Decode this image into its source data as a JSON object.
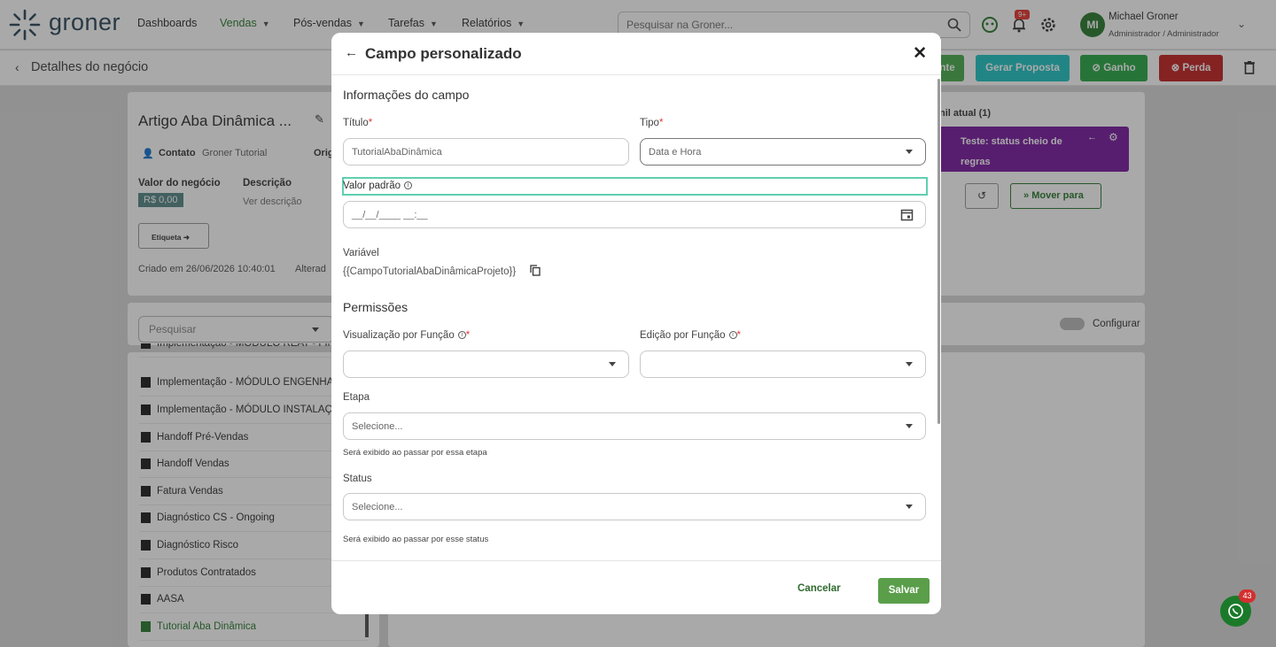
{
  "brand": {
    "name": "groner",
    "color": "#2f4b5c",
    "accent": "#2e7d32"
  },
  "nav": {
    "items": [
      {
        "label": "Dashboards",
        "dropdown": false
      },
      {
        "label": "Vendas",
        "dropdown": true,
        "active": true
      },
      {
        "label": "Pós-vendas",
        "dropdown": true
      },
      {
        "label": "Tarefas",
        "dropdown": true
      },
      {
        "label": "Relatórios",
        "dropdown": true
      }
    ],
    "search_placeholder": "Pesquisar na Groner...",
    "notifications_badge": "9+",
    "user": {
      "initials": "MI",
      "name": "Michael Groner",
      "role": "Administrador / Administrador"
    }
  },
  "subheader": {
    "title": "Detalhes do negócio",
    "buttons": {
      "ganhar_partial": "nte",
      "proposta": "Gerar Proposta",
      "ganho": "Ganho",
      "perda": "Perda"
    }
  },
  "deal": {
    "title": "Artigo Aba Dinâmica ...",
    "contact_label": "Contato",
    "contact_value": "Groner Tutorial",
    "origin_partial": "Orig",
    "value_label": "Valor do negócio",
    "value": "R$ 0,00",
    "desc_label": "Descrição",
    "desc_link": "Ver descrição",
    "tag_button": "Etiqueta",
    "created": "Criado em 26/06/2026 10:40:01",
    "changed_partial": "Alterad"
  },
  "funnel": {
    "header_partial": "nil atual (1)",
    "status_card": "Teste: status cheio de regras",
    "move_button": "Mover para"
  },
  "tabs_area": {
    "config_label": "Configurar"
  },
  "list": {
    "search_placeholder": "Pesquisar",
    "rows": [
      "Implementação - MÓDULO REAT - FIN",
      "Implementação - MÓDULO ENGENHAR",
      "Implementação - MÓDULO INSTALAÇÃ",
      "Handoff Pré-Vendas",
      "Handoff Vendas",
      "Fatura Vendas",
      "Diagnóstico CS - Ongoing",
      "Diagnóstico Risco",
      "Produtos Contratados",
      "AASA",
      "Tutorial Aba Dinâmica"
    ]
  },
  "modal": {
    "title": "Campo personalizado",
    "section_info": "Informações do campo",
    "titulo_label": "Título",
    "titulo_value": "TutorialAbaDinâmica",
    "tipo_label": "Tipo",
    "tipo_value": "Data e Hora",
    "valor_padrao_label": "Valor padrão",
    "valor_padrao_value": "__/__/____ __:__",
    "variavel_label": "Variável",
    "variavel_value": "{{CampoTutorialAbaDinâmicaProjeto}}",
    "section_perm": "Permissões",
    "visualizacao_label": "Visualização por Função",
    "edicao_label": "Edição por Função",
    "etapa_label": "Etapa",
    "etapa_placeholder": "Selecione...",
    "etapa_helper": "Será exibido ao passar por essa etapa",
    "status_label": "Status",
    "status_placeholder": "Selecione...",
    "status_helper": "Será exibido ao passar por esse status",
    "cancel": "Cancelar",
    "save": "Salvar"
  },
  "whatsapp": {
    "badge": "43"
  }
}
